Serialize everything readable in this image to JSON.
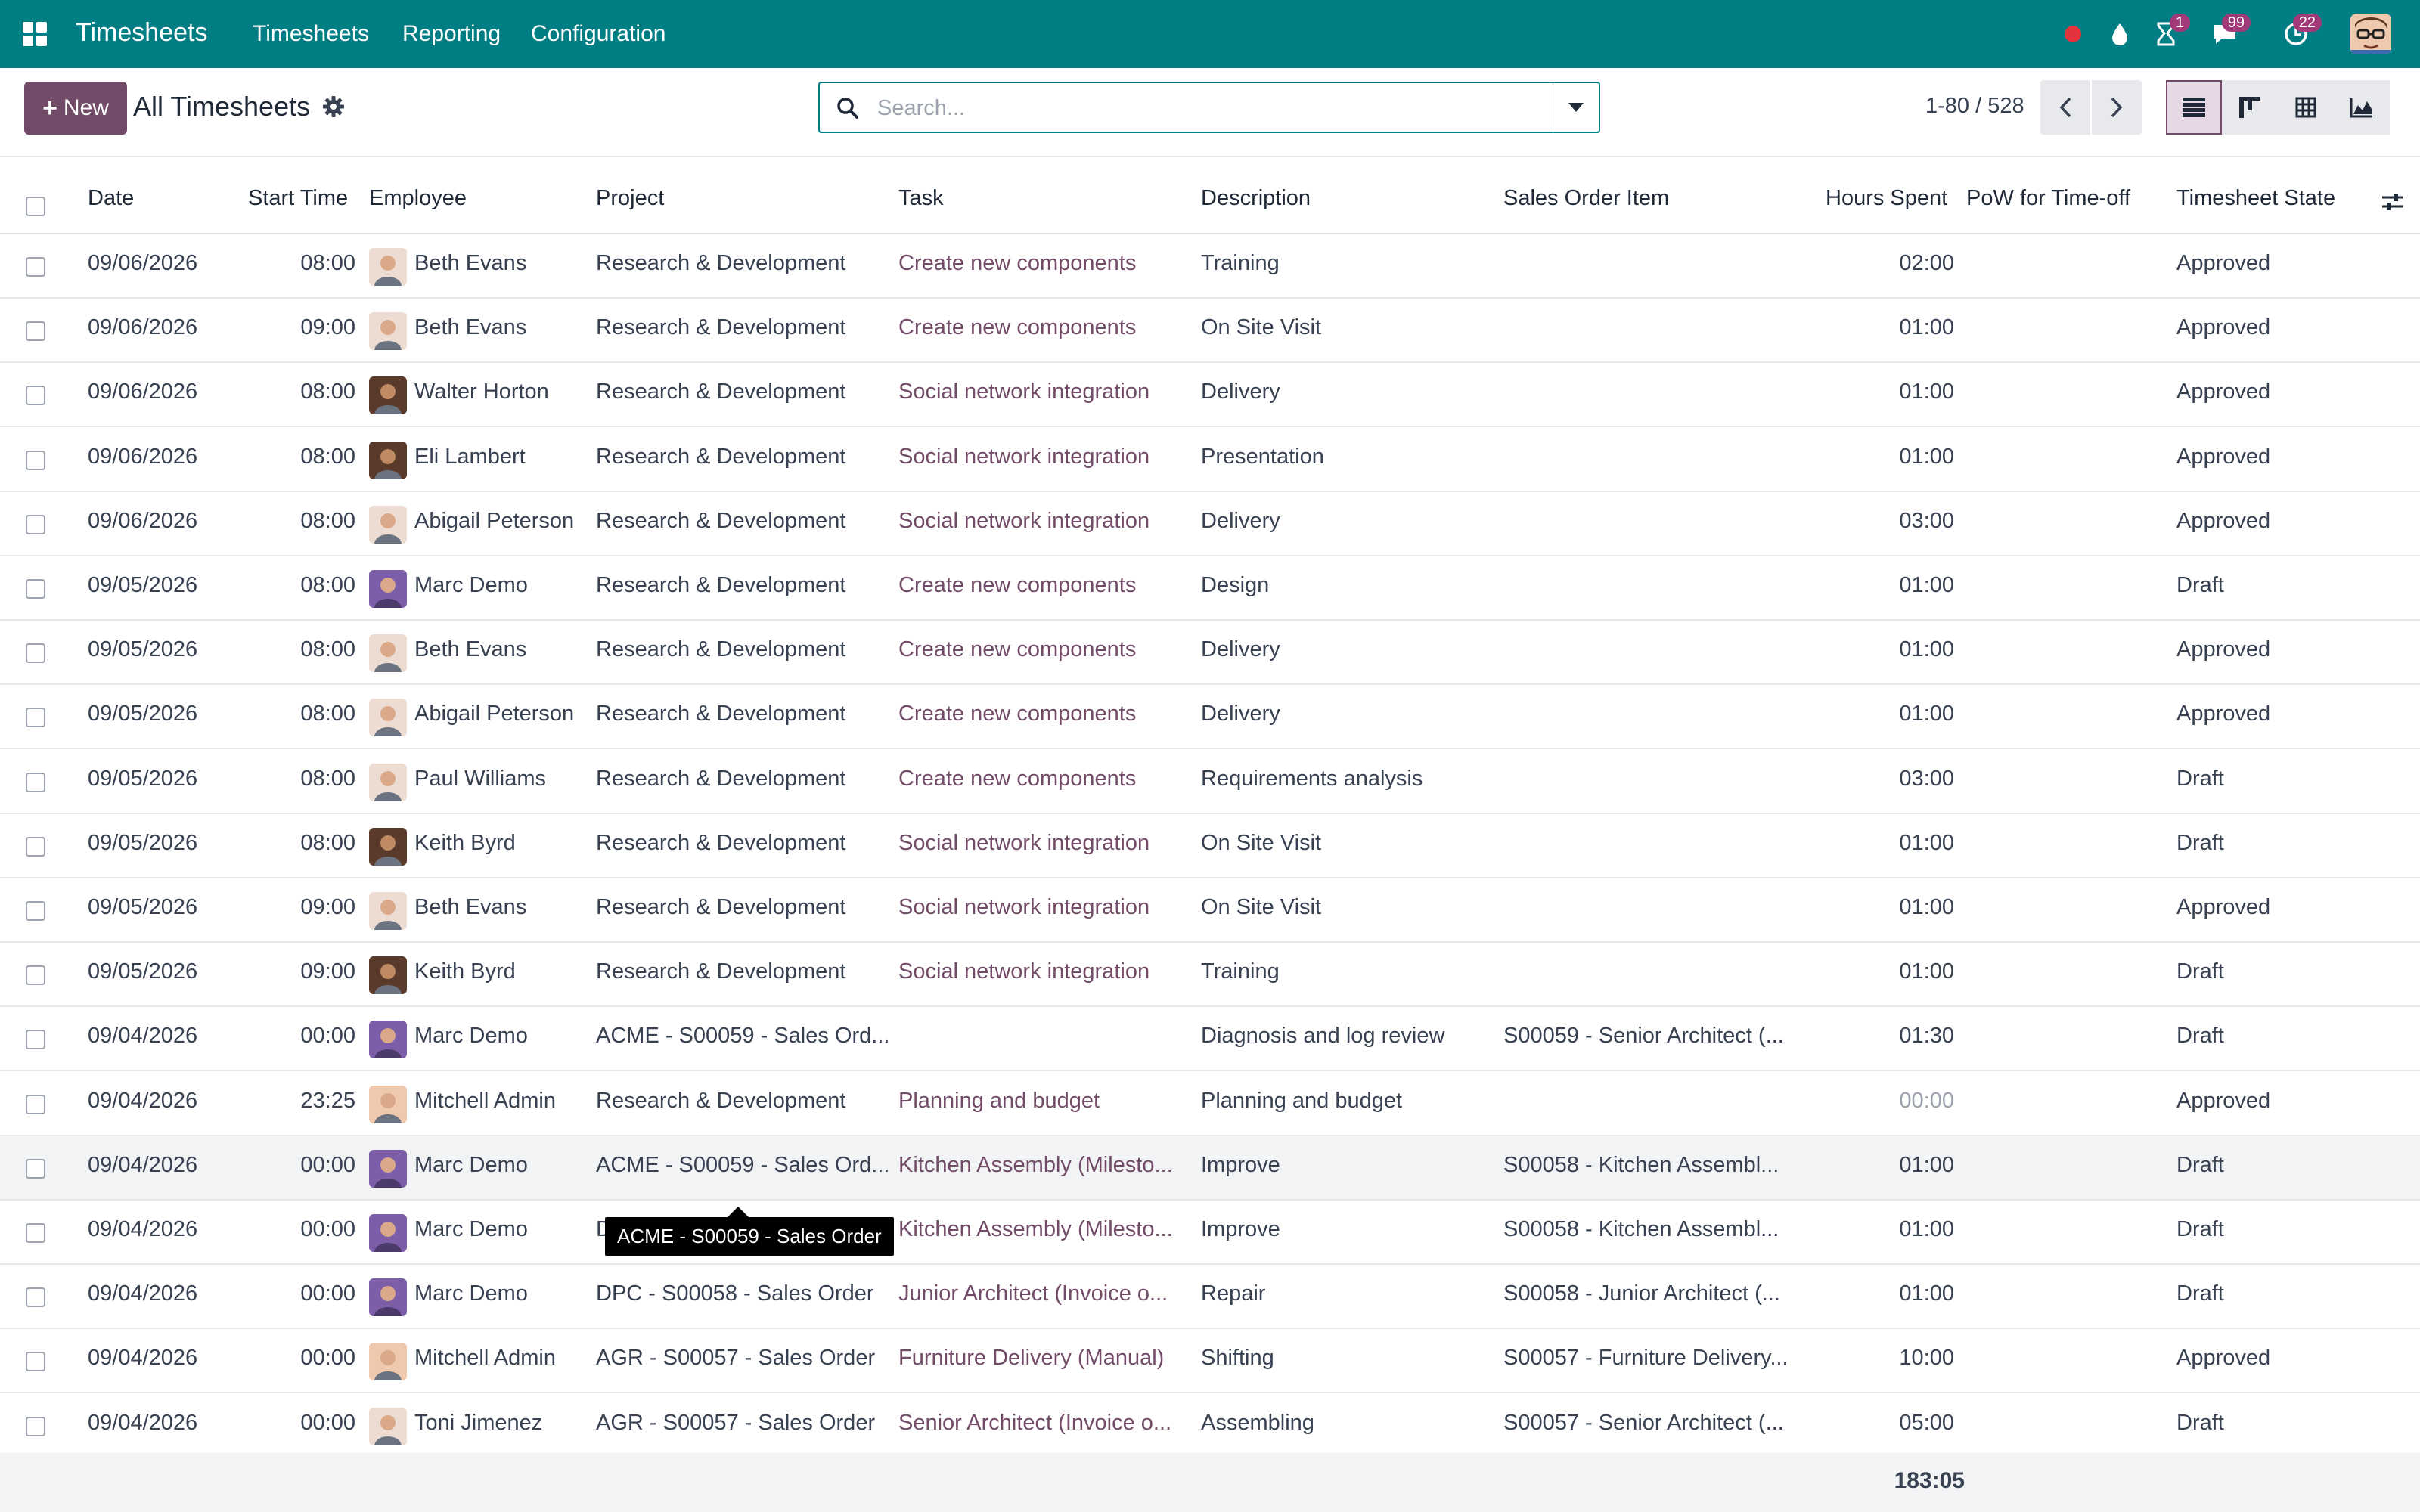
{
  "navbar": {
    "app_title": "Timesheets",
    "menus": [
      "Timesheets",
      "Reporting",
      "Configuration"
    ],
    "activity_badge": "1",
    "messages_badge": "99",
    "updates_badge": "22",
    "accent": "#017e84"
  },
  "control": {
    "new_label": "New",
    "title": "All Timesheets",
    "search_placeholder": "Search...",
    "pager": "1-80 / 528"
  },
  "table": {
    "columns": {
      "date": "Date",
      "start_time": "Start Time",
      "employee": "Employee",
      "project": "Project",
      "task": "Task",
      "description": "Description",
      "sales_order_item": "Sales Order Item",
      "hours_spent": "Hours Spent",
      "pow": "PoW for Time-off",
      "state": "Timesheet State"
    },
    "rows": [
      {
        "date": "09/06/2026",
        "start": "08:00",
        "employee": "Beth Evans",
        "avatar": "light",
        "project": "Research & Development",
        "task": "Create new components",
        "description": "Training",
        "soi": "",
        "hours": "02:00",
        "state": "Approved"
      },
      {
        "date": "09/06/2026",
        "start": "09:00",
        "employee": "Beth Evans",
        "avatar": "light",
        "project": "Research & Development",
        "task": "Create new components",
        "description": "On Site Visit",
        "soi": "",
        "hours": "01:00",
        "state": "Approved"
      },
      {
        "date": "09/06/2026",
        "start": "08:00",
        "employee": "Walter Horton",
        "avatar": "dark",
        "project": "Research & Development",
        "task": "Social network integration",
        "description": "Delivery",
        "soi": "",
        "hours": "01:00",
        "state": "Approved"
      },
      {
        "date": "09/06/2026",
        "start": "08:00",
        "employee": "Eli Lambert",
        "avatar": "dark",
        "project": "Research & Development",
        "task": "Social network integration",
        "description": "Presentation",
        "soi": "",
        "hours": "01:00",
        "state": "Approved"
      },
      {
        "date": "09/06/2026",
        "start": "08:00",
        "employee": "Abigail Peterson",
        "avatar": "light",
        "project": "Research & Development",
        "task": "Social network integration",
        "description": "Delivery",
        "soi": "",
        "hours": "03:00",
        "state": "Approved"
      },
      {
        "date": "09/05/2026",
        "start": "08:00",
        "employee": "Marc Demo",
        "avatar": "purple",
        "project": "Research & Development",
        "task": "Create new components",
        "description": "Design",
        "soi": "",
        "hours": "01:00",
        "state": "Draft"
      },
      {
        "date": "09/05/2026",
        "start": "08:00",
        "employee": "Beth Evans",
        "avatar": "light",
        "project": "Research & Development",
        "task": "Create new components",
        "description": "Delivery",
        "soi": "",
        "hours": "01:00",
        "state": "Approved"
      },
      {
        "date": "09/05/2026",
        "start": "08:00",
        "employee": "Abigail Peterson",
        "avatar": "light",
        "project": "Research & Development",
        "task": "Create new components",
        "description": "Delivery",
        "soi": "",
        "hours": "01:00",
        "state": "Approved"
      },
      {
        "date": "09/05/2026",
        "start": "08:00",
        "employee": "Paul Williams",
        "avatar": "light",
        "project": "Research & Development",
        "task": "Create new components",
        "description": "Requirements analysis",
        "soi": "",
        "hours": "03:00",
        "state": "Draft"
      },
      {
        "date": "09/05/2026",
        "start": "08:00",
        "employee": "Keith Byrd",
        "avatar": "dark",
        "project": "Research & Development",
        "task": "Social network integration",
        "description": "On Site Visit",
        "soi": "",
        "hours": "01:00",
        "state": "Draft"
      },
      {
        "date": "09/05/2026",
        "start": "09:00",
        "employee": "Beth Evans",
        "avatar": "light",
        "project": "Research & Development",
        "task": "Social network integration",
        "description": "On Site Visit",
        "soi": "",
        "hours": "01:00",
        "state": "Approved"
      },
      {
        "date": "09/05/2026",
        "start": "09:00",
        "employee": "Keith Byrd",
        "avatar": "dark",
        "project": "Research & Development",
        "task": "Social network integration",
        "description": "Training",
        "soi": "",
        "hours": "01:00",
        "state": "Draft"
      },
      {
        "date": "09/04/2026",
        "start": "00:00",
        "employee": "Marc Demo",
        "avatar": "purple",
        "project": "ACME - S00059 - Sales Ord...",
        "task": "",
        "description": "Diagnosis and log review",
        "soi": "S00059 - Senior Architect (...",
        "hours": "01:30",
        "state": "Draft"
      },
      {
        "date": "09/04/2026",
        "start": "23:25",
        "employee": "Mitchell Admin",
        "avatar": "admin",
        "project": "Research & Development",
        "task": "Planning and budget",
        "description": "Planning and budget",
        "soi": "",
        "hours": "00:00",
        "state": "Approved",
        "muted": true
      },
      {
        "date": "09/04/2026",
        "start": "00:00",
        "employee": "Marc Demo",
        "avatar": "purple",
        "project": "ACME - S00059 - Sales Ord...",
        "task": "Kitchen Assembly (Milesto...",
        "description": "Improve",
        "soi": "S00058 - Kitchen Assembl...",
        "hours": "01:00",
        "state": "Draft",
        "highlight": true
      },
      {
        "date": "09/04/2026",
        "start": "00:00",
        "employee": "Marc Demo",
        "avatar": "purple",
        "project": "D",
        "task": "Kitchen Assembly (Milesto...",
        "description": "Improve",
        "soi": "S00058 - Kitchen Assembl...",
        "hours": "01:00",
        "state": "Draft"
      },
      {
        "date": "09/04/2026",
        "start": "00:00",
        "employee": "Marc Demo",
        "avatar": "purple",
        "project": "DPC - S00058 - Sales Order",
        "task": "Junior Architect (Invoice o...",
        "description": "Repair",
        "soi": "S00058 - Junior Architect (...",
        "hours": "01:00",
        "state": "Draft"
      },
      {
        "date": "09/04/2026",
        "start": "00:00",
        "employee": "Mitchell Admin",
        "avatar": "admin",
        "project": "AGR - S00057 - Sales Order",
        "task": "Furniture Delivery (Manual)",
        "description": "Shifting",
        "soi": "S00057 - Furniture Delivery...",
        "hours": "10:00",
        "state": "Approved"
      },
      {
        "date": "09/04/2026",
        "start": "00:00",
        "employee": "Toni Jimenez",
        "avatar": "light",
        "project": "AGR - S00057 - Sales Order",
        "task": "Senior Architect (Invoice o...",
        "description": "Assembling",
        "soi": "S00057 - Senior Architect (...",
        "hours": "05:00",
        "state": "Draft"
      }
    ],
    "total_hours": "183:05"
  },
  "tooltip": {
    "text": "ACME - S00059 - Sales Order"
  }
}
